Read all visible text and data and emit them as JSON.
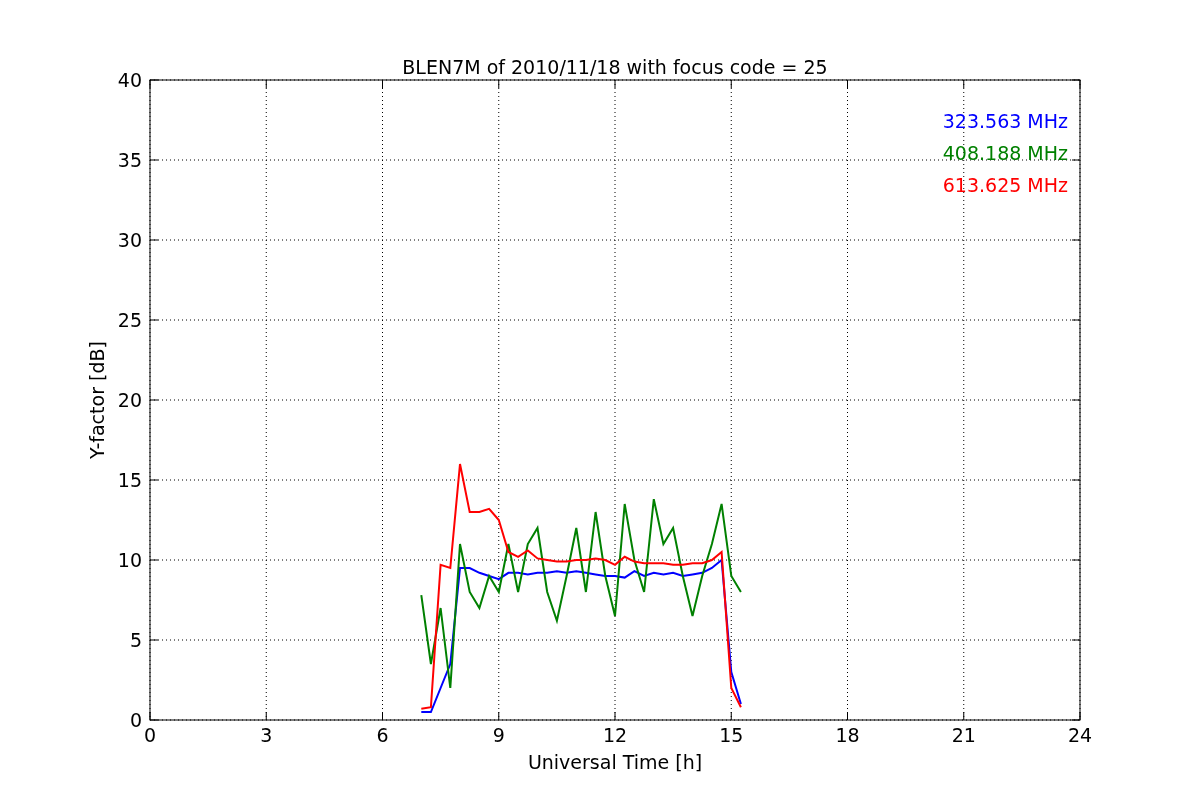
{
  "chart_data": {
    "type": "line",
    "title": "BLEN7M of 2010/11/18 with focus code = 25",
    "xlabel": "Universal Time [h]",
    "ylabel": "Y-factor [dB]",
    "x": [
      7,
      7.25,
      7.5,
      7.75,
      8,
      8.25,
      8.5,
      8.75,
      9,
      9.25,
      9.5,
      9.75,
      10,
      10.25,
      10.5,
      10.75,
      11,
      11.25,
      11.5,
      11.75,
      12,
      12.25,
      12.5,
      12.75,
      13,
      13.25,
      13.5,
      13.75,
      14,
      14.25,
      14.5,
      14.75,
      15,
      15.25
    ],
    "series": [
      {
        "name": "323.563 MHz",
        "color": "#0000ff",
        "values": [
          0.5,
          0.5,
          2,
          3.5,
          9.5,
          9.5,
          9.2,
          9,
          8.8,
          9.2,
          9.2,
          9.1,
          9.2,
          9.2,
          9.3,
          9.2,
          9.3,
          9.2,
          9.1,
          9,
          9,
          8.9,
          9.3,
          9,
          9.2,
          9.1,
          9.2,
          9,
          9.1,
          9.2,
          9.5,
          10,
          3,
          1
        ]
      },
      {
        "name": "408.188 MHz",
        "color": "#008000",
        "values": [
          7.8,
          3.5,
          7,
          2,
          11,
          8,
          7,
          9,
          8,
          11,
          8,
          11,
          12,
          8,
          6.2,
          9,
          12,
          8,
          13,
          9,
          6.5,
          13.5,
          10,
          8,
          13.8,
          11,
          12,
          9,
          6.5,
          9,
          11,
          13.5,
          9,
          8
        ]
      },
      {
        "name": "613.625 MHz",
        "color": "#ff0000",
        "values": [
          0.7,
          0.8,
          9.7,
          9.5,
          16,
          13,
          13,
          13.2,
          12.5,
          10.5,
          10.2,
          10.6,
          10.1,
          10,
          9.9,
          9.9,
          10,
          10,
          10.1,
          10,
          9.7,
          10.2,
          9.9,
          9.8,
          9.8,
          9.8,
          9.7,
          9.7,
          9.8,
          9.8,
          10,
          10.5,
          2,
          0.8
        ]
      }
    ],
    "grid": true,
    "xlim": [
      0,
      24
    ],
    "ylim": [
      0,
      40
    ],
    "xticks": [
      0,
      3,
      6,
      9,
      12,
      15,
      18,
      21,
      24
    ],
    "yticks": [
      0,
      5,
      10,
      15,
      20,
      25,
      30,
      35,
      40
    ]
  }
}
